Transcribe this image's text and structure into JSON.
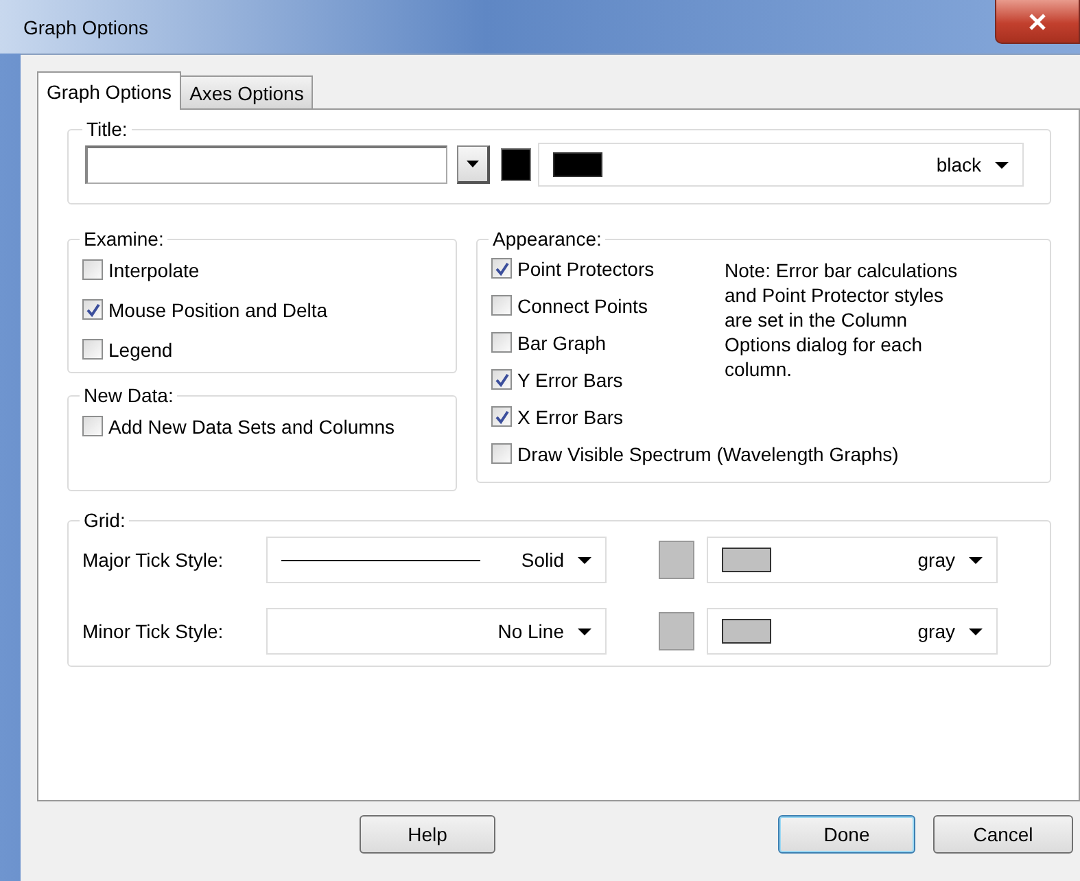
{
  "window": {
    "title": "Graph Options"
  },
  "tabs": [
    {
      "label": "Graph Options",
      "selected": true
    },
    {
      "label": "Axes Options",
      "selected": false
    }
  ],
  "title_group": {
    "legend": "Title:",
    "color": "#000000",
    "color_name": "black"
  },
  "examine": {
    "legend": "Examine:",
    "options": [
      {
        "label": "Interpolate",
        "checked": false
      },
      {
        "label": "Mouse Position and Delta",
        "checked": true
      },
      {
        "label": "Legend",
        "checked": false
      }
    ]
  },
  "new_data": {
    "legend": "New Data:",
    "options": [
      {
        "label": "Add New Data Sets and Columns",
        "checked": false
      }
    ]
  },
  "appearance": {
    "legend": "Appearance:",
    "options": [
      {
        "label": "Point Protectors",
        "checked": true
      },
      {
        "label": "Connect Points",
        "checked": false
      },
      {
        "label": "Bar Graph",
        "checked": false
      },
      {
        "label": "Y Error Bars",
        "checked": true
      },
      {
        "label": "X Error Bars",
        "checked": true
      },
      {
        "label": "Draw Visible Spectrum (Wavelength Graphs)",
        "checked": false
      }
    ],
    "note": "Note:  Error bar calculations and Point Protector styles are set in the Column Options dialog for each column."
  },
  "grid": {
    "legend": "Grid:",
    "rows": [
      {
        "label": "Major Tick Style:",
        "style": "Solid",
        "line": true,
        "color": "#c0c0c0",
        "color_name": "gray"
      },
      {
        "label": "Minor Tick Style:",
        "style": "No Line",
        "line": false,
        "color": "#c0c0c0",
        "color_name": "gray"
      }
    ]
  },
  "buttons": [
    {
      "label": "Help",
      "default": false
    },
    {
      "label": "Done",
      "default": true
    },
    {
      "label": "Cancel",
      "default": false
    }
  ]
}
